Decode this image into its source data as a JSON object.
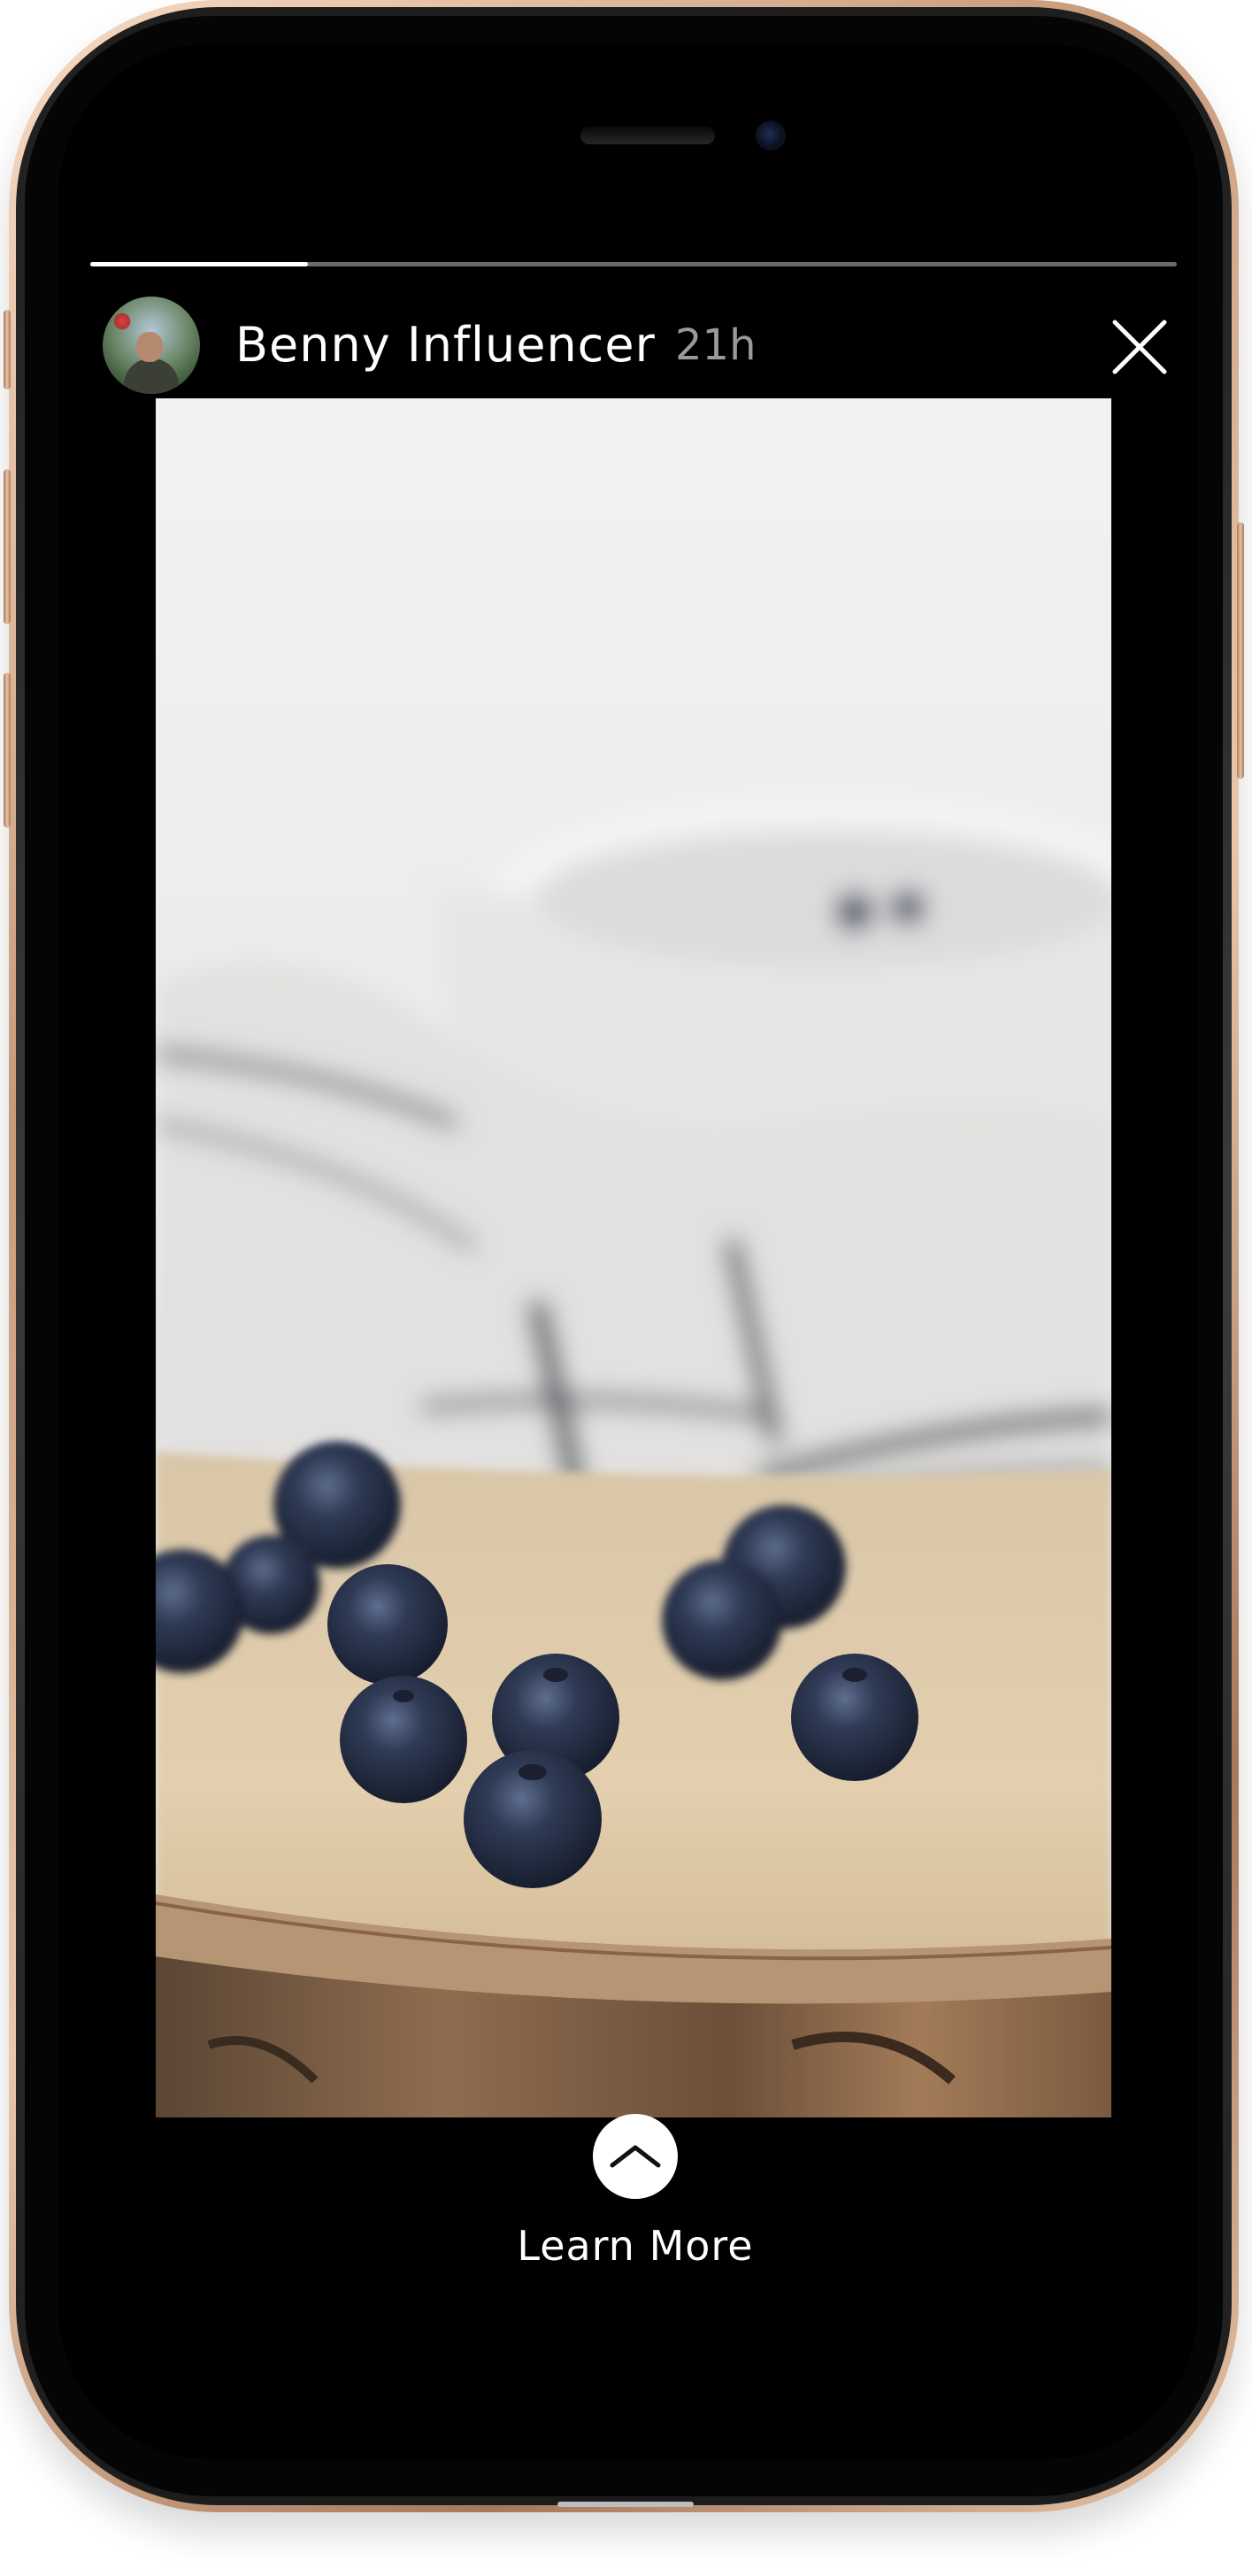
{
  "story": {
    "username": "Benny Influencer",
    "timestamp": "21h",
    "progress": 0.2,
    "cta_label": "Learn More"
  },
  "icons": {
    "close": "close-icon",
    "cta": "chevron-up-icon",
    "avatar": "avatar"
  },
  "colors": {
    "background": "#000000",
    "text": "#ffffff",
    "timestamp": "#9a9a9a",
    "progress_track": "#6b6b6b",
    "progress_fill": "#ffffff"
  }
}
